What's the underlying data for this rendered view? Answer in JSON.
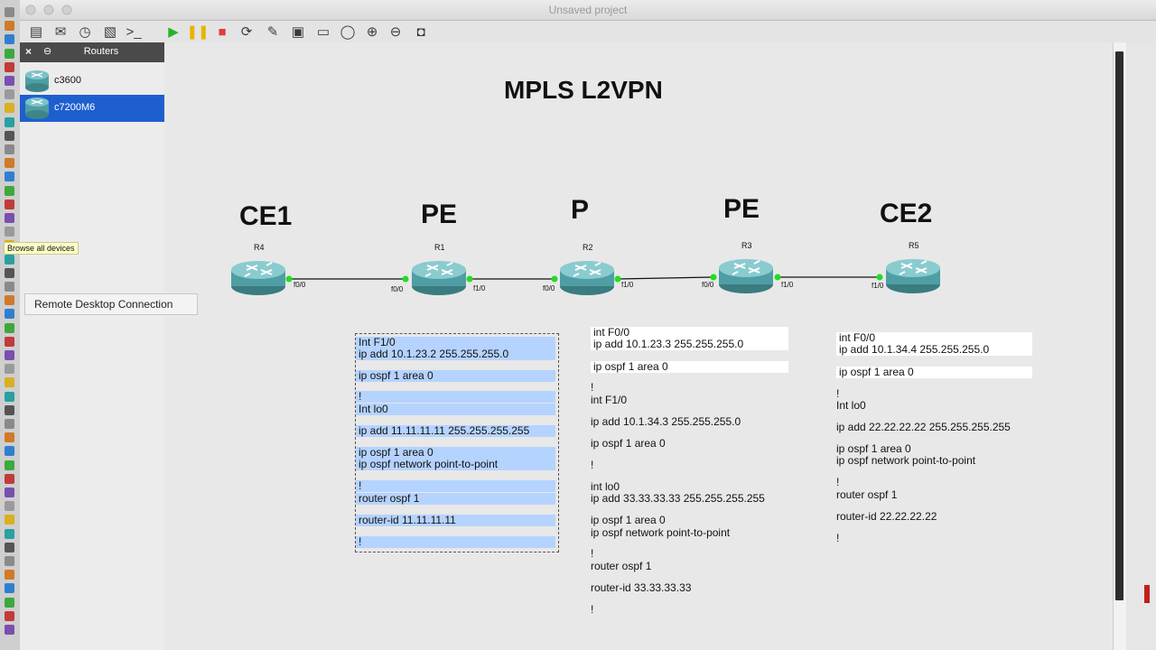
{
  "window": {
    "title": "Unsaved project"
  },
  "toolbar": {
    "buttons": [
      {
        "name": "open-folder-icon",
        "glyph": "▤"
      },
      {
        "name": "save-project-icon",
        "glyph": "✉"
      },
      {
        "name": "clock-icon",
        "glyph": "◷"
      },
      {
        "name": "snapshot-icon",
        "glyph": "▧"
      },
      {
        "name": "console-icon",
        "glyph": ">_"
      },
      {
        "name": "start-all-icon",
        "glyph": "▶",
        "color": "#27b327"
      },
      {
        "name": "suspend-all-icon",
        "glyph": "❚❚",
        "color": "#e8b400"
      },
      {
        "name": "stop-all-icon",
        "glyph": "■",
        "color": "#e23c3c"
      },
      {
        "name": "reload-icon",
        "glyph": "⟳"
      },
      {
        "name": "edit-note-icon",
        "glyph": "✎"
      },
      {
        "name": "insert-picture-icon",
        "glyph": "▣"
      },
      {
        "name": "draw-rectangle-icon",
        "glyph": "▭"
      },
      {
        "name": "draw-ellipse-icon",
        "glyph": "◯"
      },
      {
        "name": "zoom-in-icon",
        "glyph": "⊕"
      },
      {
        "name": "zoom-out-icon",
        "glyph": "⊖"
      },
      {
        "name": "screenshot-icon",
        "glyph": "◘"
      }
    ]
  },
  "devices_panel": {
    "close": "×",
    "float": "⊖",
    "title": "Routers",
    "items": [
      {
        "label": "c3600",
        "selected": false
      },
      {
        "label": "c7200M6",
        "selected": true
      }
    ]
  },
  "dock": {
    "tooltip": "Browse all devices",
    "popup": "Remote Desktop Connection"
  },
  "topology": {
    "title": "MPLS L2VPN",
    "roles": [
      "CE1",
      "PE",
      "P",
      "PE",
      "CE2"
    ],
    "routers": [
      "R4",
      "R1",
      "R2",
      "R3",
      "R5"
    ],
    "ports": [
      "f0/0",
      "f0/0",
      "f1/0",
      "f0/0",
      "f1/0",
      "f0/0",
      "f1/0",
      "f1/0"
    ]
  },
  "configs": {
    "r1": [
      "Int F1/0",
      "ip add 10.1.23.2 255.255.255.0",
      "ip ospf 1 area 0",
      "!",
      "Int lo0",
      "ip add 11.11.11.11 255.255.255.255",
      "ip ospf 1 area 0",
      "ip ospf network point-to-point",
      "!",
      "router ospf 1",
      "router-id 11.11.11.11",
      "!"
    ],
    "r2": [
      "int F0/0",
      "ip add 10.1.23.3 255.255.255.0",
      "ip ospf 1 area 0",
      "!",
      "int F1/0",
      "ip add 10.1.34.3 255.255.255.0",
      "ip ospf 1 area 0",
      "!",
      "int lo0",
      "ip add 33.33.33.33 255.255.255.255",
      "ip ospf 1 area 0",
      "ip ospf network point-to-point",
      "!",
      "router ospf 1",
      "router-id 33.33.33.33",
      "!"
    ],
    "r3": [
      "int F0/0",
      "ip add 10.1.34.4 255.255.255.0",
      "ip ospf 1 area 0",
      "!",
      "Int lo0",
      "ip add 22.22.22.22 255.255.255.255",
      "ip ospf 1 area 0",
      "ip ospf network point-to-point",
      "!",
      "router ospf 1",
      "router-id 22.22.22.22",
      "!"
    ]
  },
  "colors": {
    "selection": "#1e5fd0",
    "highlight": "#b5d3ff",
    "port_up": "#22dd22",
    "router_body": "#4f9ea4"
  }
}
